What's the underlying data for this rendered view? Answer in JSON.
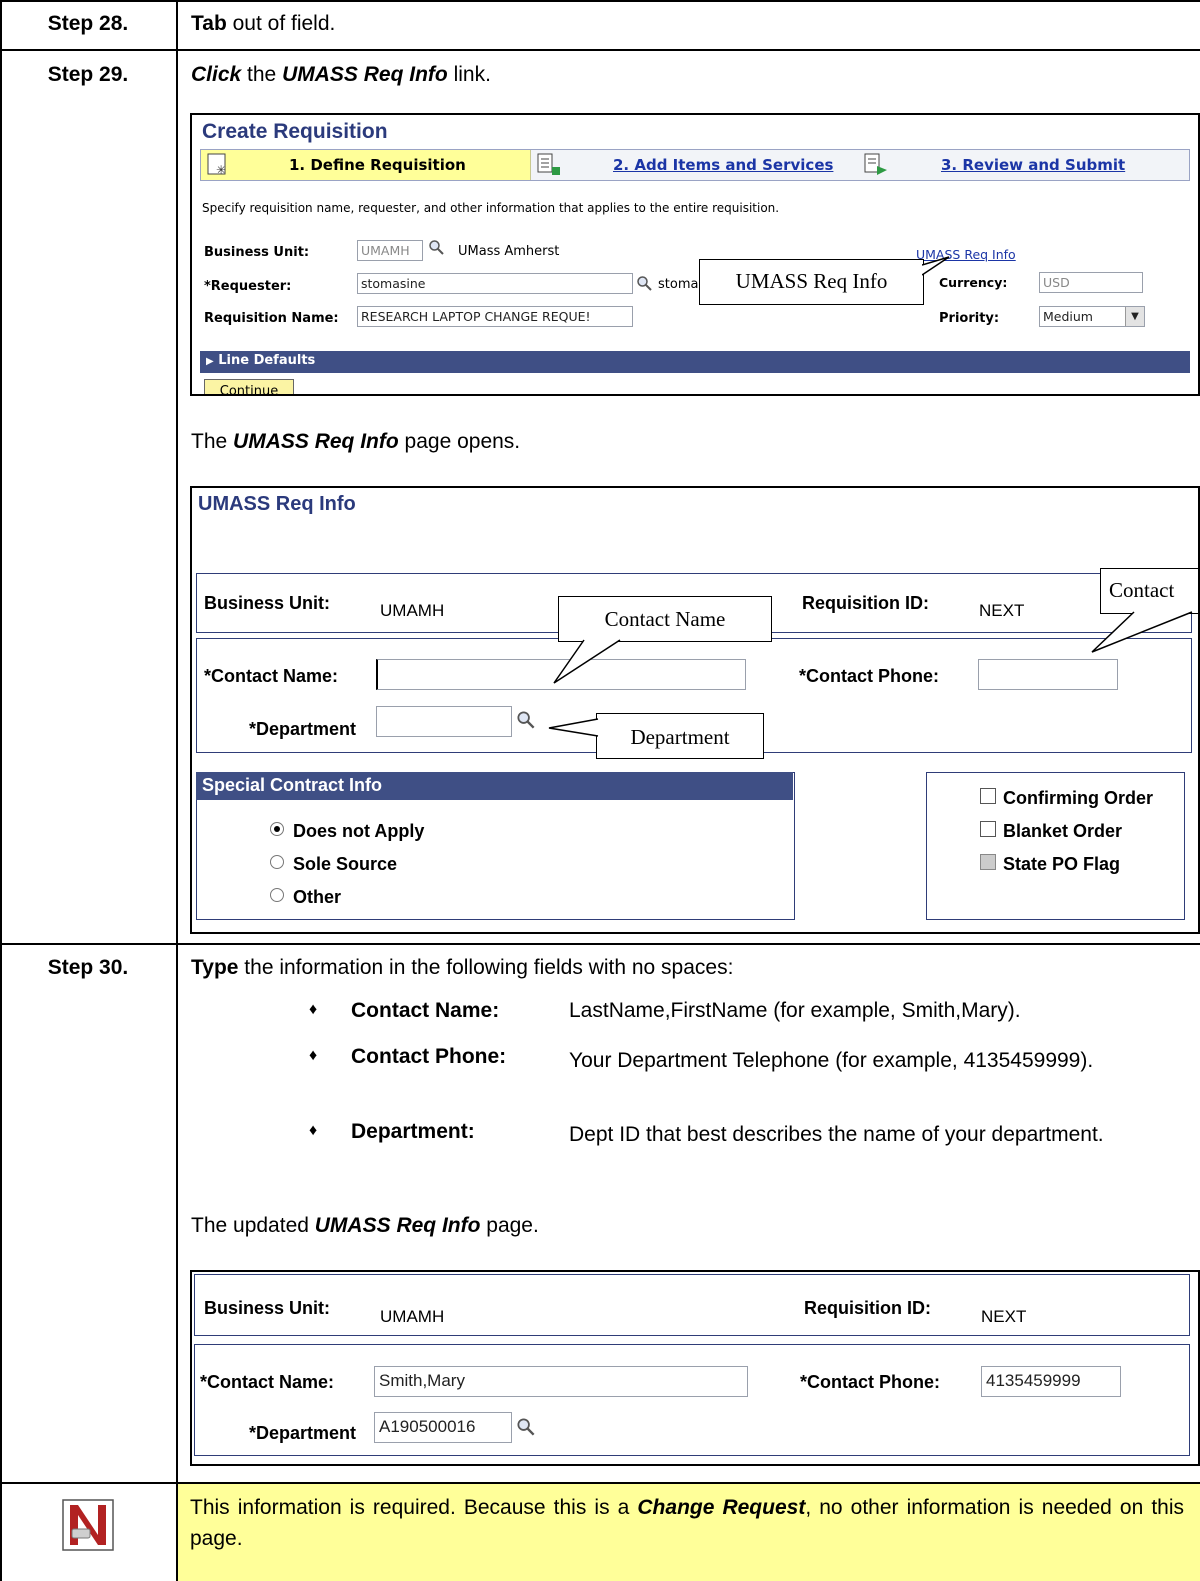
{
  "steps": {
    "s28": {
      "label": "Step 28.",
      "verb": "Tab",
      "text": " out of field."
    },
    "s29": {
      "label": "Step 29.",
      "verb": "Click",
      "text_a": " the ",
      "link": "UMASS Req Info",
      "text_b": " link."
    },
    "s30": {
      "label": "Step 30.",
      "verb": "Type",
      "text": " the information in the following fields with no spaces:"
    }
  },
  "create_req": {
    "title": "Create Requisition",
    "train": {
      "step1": "1. Define Requisition",
      "step2": "2. Add Items and Services",
      "step3": "3. Review and Submit"
    },
    "intro": "Specify requisition name, requester, and other information that applies to the entire requisition.",
    "business_unit_label": "Business Unit:",
    "business_unit_value": "UMAMH",
    "business_unit_desc": "UMass Amherst",
    "umass_link": "UMASS Req Info",
    "requester_label": "*Requester:",
    "requester_value": "stomasine",
    "requester_desc": "stoma",
    "currency_label": "Currency:",
    "currency_value": "USD",
    "req_name_label": "Requisition Name:",
    "req_name_value": "RESEARCH LAPTOP CHANGE REQUE!",
    "priority_label": "Priority:",
    "priority_value": "Medium",
    "line_defaults": "Line Defaults",
    "continue": "Continue",
    "callout": "UMASS Req Info"
  },
  "opens": {
    "a": "The ",
    "bi": "UMASS Req Info",
    "b": " page opens."
  },
  "umass": {
    "title": "UMASS Req Info",
    "bu_label": "Business Unit:",
    "bu_value": "UMAMH",
    "reqid_label": "Requisition ID:",
    "reqid_value": "NEXT",
    "contact_name_label": "*Contact Name:",
    "contact_name_value": "",
    "contact_phone_label": "*Contact Phone:",
    "contact_phone_value": "",
    "department_label": "*Department",
    "department_value": "",
    "sci_title": "Special Contract Info",
    "radio_options": [
      "Does not Apply",
      "Sole Source",
      "Other"
    ],
    "radio_selected": "Does not Apply",
    "checkboxes": [
      "Confirming Order",
      "Blanket Order",
      "State PO Flag"
    ],
    "callout_contact_name": "Contact Name",
    "callout_contact_phone": "Contact",
    "callout_department": "Department"
  },
  "fields": [
    {
      "name": "Contact Name:",
      "desc": "LastName,FirstName (for example, Smith,Mary)."
    },
    {
      "name": "Contact Phone:",
      "desc": "Your Department Telephone (for example, 4135459999)."
    },
    {
      "name": "Department:",
      "desc": "Dept ID that best describes the name of your department."
    }
  ],
  "updated": {
    "a": "The updated ",
    "bi": "UMASS Req Info",
    "b": " page."
  },
  "umass2": {
    "bu_label": "Business Unit:",
    "bu_value": "UMAMH",
    "reqid_label": "Requisition ID:",
    "reqid_value": "NEXT",
    "contact_name_label": "*Contact Name:",
    "contact_name_value": "Smith,Mary",
    "contact_phone_label": "*Contact Phone:",
    "contact_phone_value": "4135459999",
    "department_label": "*Department",
    "department_value": "A190500016"
  },
  "note": {
    "a": "This information is required. Because this is a ",
    "bi": "Change Request",
    "b": ", no other information is needed on this page."
  },
  "colors": {
    "ps_title": "#2b3a7c",
    "ps_header_bar": "#3f4f85",
    "train_active": "#ffff99",
    "note_bg": "#ffff99",
    "link": "#1b35a6"
  }
}
